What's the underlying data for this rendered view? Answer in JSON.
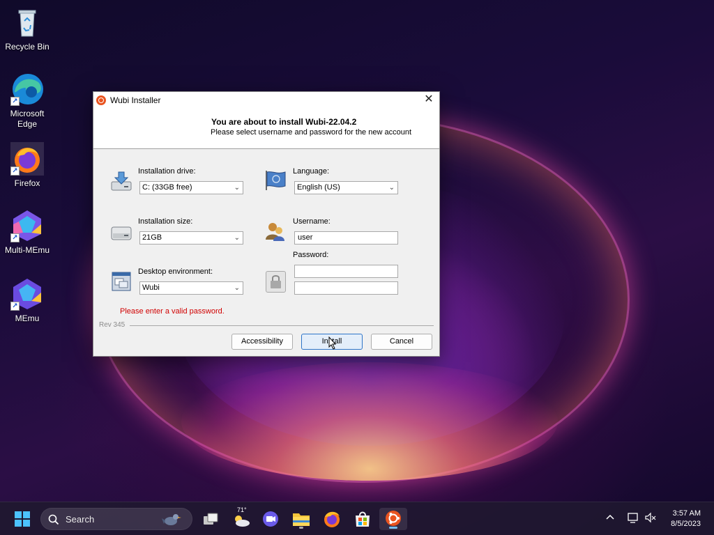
{
  "desktop": {
    "icons": [
      {
        "label": "Recycle Bin"
      },
      {
        "label": "Microsoft Edge"
      },
      {
        "label": "Firefox"
      },
      {
        "label": "Multi-MEmu"
      },
      {
        "label": "MEmu"
      }
    ]
  },
  "dialog": {
    "title": "Wubi Installer",
    "close_glyph": "✕",
    "header_title": "You are about to install Wubi-22.04.2",
    "header_subtitle": "Please select username and password for the new account",
    "installation_drive_label": "Installation drive:",
    "installation_drive_value": "C: (33GB free)",
    "installation_size_label": "Installation size:",
    "installation_size_value": "21GB",
    "desktop_env_label": "Desktop environment:",
    "desktop_env_value": "Wubi",
    "language_label": "Language:",
    "language_value": "English (US)",
    "username_label": "Username:",
    "username_value": "user",
    "password_label": "Password:",
    "password_value": "",
    "password_confirm_value": "",
    "error": "Please enter a valid password.",
    "revision": "Rev 345",
    "buttons": {
      "accessibility": "Accessibility",
      "install": "Install",
      "cancel": "Cancel"
    }
  },
  "taskbar": {
    "search_label": "Search",
    "weather_temp": "71°",
    "time": "3:57 AM",
    "date": "8/5/2023"
  },
  "colors": {
    "accent": "#2d74c8",
    "error": "#d00000",
    "ubuntu": "#e95420"
  }
}
